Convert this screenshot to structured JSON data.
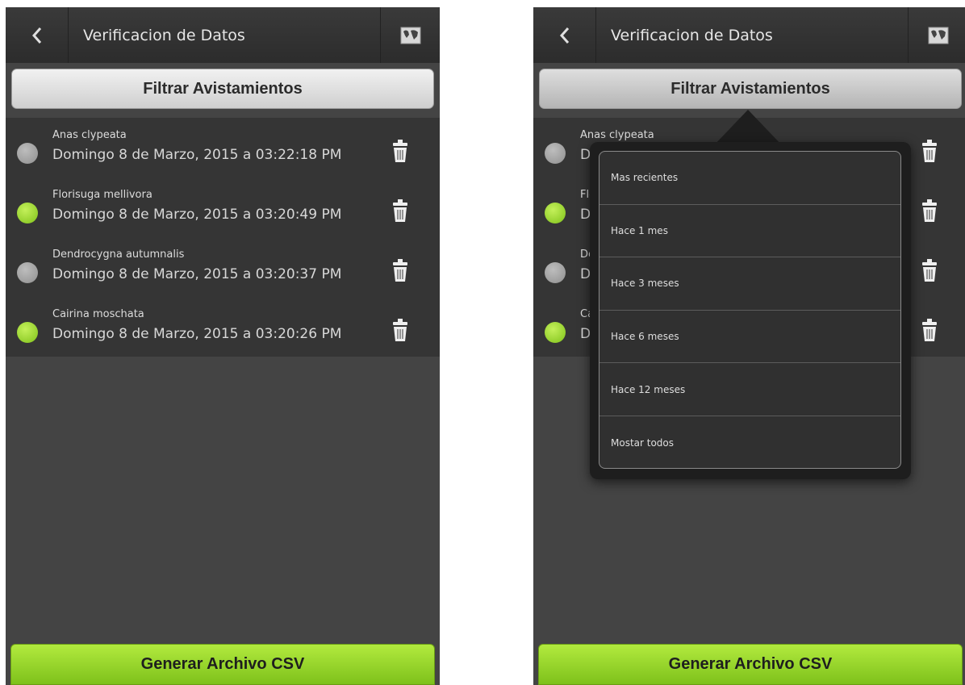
{
  "header": {
    "title": "Verificacion de Datos"
  },
  "filter_button_label": "Filtrar Avistamientos",
  "csv_button_label": "Generar Archivo CSV",
  "sightings": [
    {
      "species": "Anas clypeata",
      "date": "Domingo 8 de Marzo, 2015 a 03:22:18 PM",
      "status_color": "gray"
    },
    {
      "species": "Florisuga mellivora",
      "date": "Domingo 8 de Marzo, 2015 a 03:20:49 PM",
      "status_color": "green"
    },
    {
      "species": "Dendrocygna autumnalis",
      "date": "Domingo 8 de Marzo, 2015 a 03:20:37 PM",
      "status_color": "gray"
    },
    {
      "species": "Cairina moschata",
      "date": "Domingo 8 de Marzo, 2015 a 03:20:26 PM",
      "status_color": "green"
    }
  ],
  "filter_menu": {
    "options": [
      "Mas recientes",
      "Hace 1 mes",
      "Hace 3 meses",
      "Hace 6 meses",
      "Hace 12 meses",
      "Mostar todos"
    ]
  },
  "colors": {
    "background": "#444444",
    "list_background": "#353535",
    "accent_green": "#8fd024",
    "status_gray": "#9e9e9e"
  }
}
